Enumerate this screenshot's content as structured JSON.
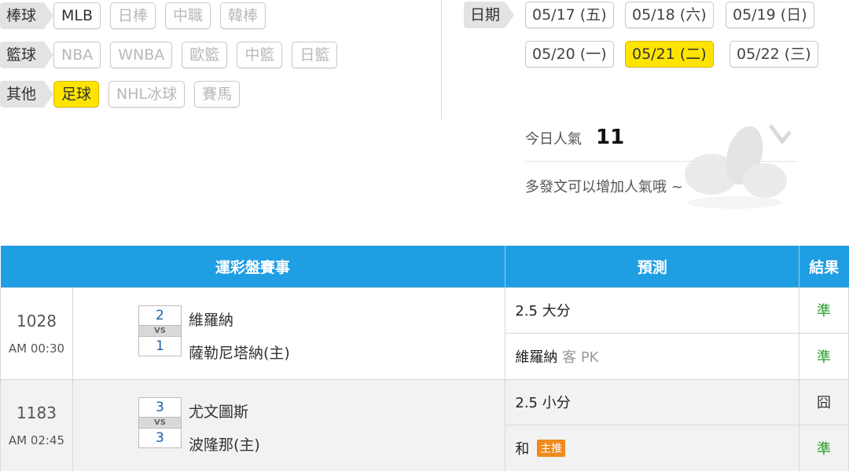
{
  "filters": {
    "baseball": {
      "label": "棒球",
      "items": [
        "MLB",
        "日棒",
        "中職",
        "韓棒"
      ]
    },
    "basketball": {
      "label": "籃球",
      "items": [
        "NBA",
        "WNBA",
        "歐籃",
        "中籃",
        "日籃"
      ]
    },
    "other": {
      "label": "其他",
      "items": [
        "足球",
        "NHL冰球",
        "賽馬"
      ]
    }
  },
  "dates": {
    "label": "日期",
    "items": [
      "05/17 (五)",
      "05/18 (六)",
      "05/19 (日)",
      "05/20 (一)",
      "05/21 (二)",
      "05/22 (三)"
    ],
    "selected": "05/21 (二)"
  },
  "popularity": {
    "label": "今日人氣",
    "value": "11",
    "hint": "多發文可以增加人氣哦 ~"
  },
  "table": {
    "headers": [
      "運彩盤賽事",
      "預測",
      "結果"
    ],
    "games": [
      {
        "id": "1028",
        "time": "AM 00:30",
        "away_score": "2",
        "away_team": "維羅納",
        "vs": "VS",
        "home_score": "1",
        "home_team": "薩勒尼塔納(主)",
        "predictions": [
          {
            "text": "2.5 大分",
            "result": "準"
          },
          {
            "text": "維羅納",
            "extra": "客 PK",
            "result": "準"
          }
        ]
      },
      {
        "id": "1183",
        "time": "AM 02:45",
        "away_score": "3",
        "away_team": "尤文圖斯",
        "vs": "VS",
        "home_score": "3",
        "home_team": "波隆那(主)",
        "predictions": [
          {
            "text": "2.5 小分",
            "result": "囧"
          },
          {
            "text": "和",
            "badge": "主推",
            "result": "準"
          }
        ]
      }
    ]
  },
  "colors": {
    "header_blue": "#1f9ee3",
    "selected_yellow": "#ffe400",
    "result_green": "#2a9a2a",
    "badge_orange": "#f08a1c"
  }
}
